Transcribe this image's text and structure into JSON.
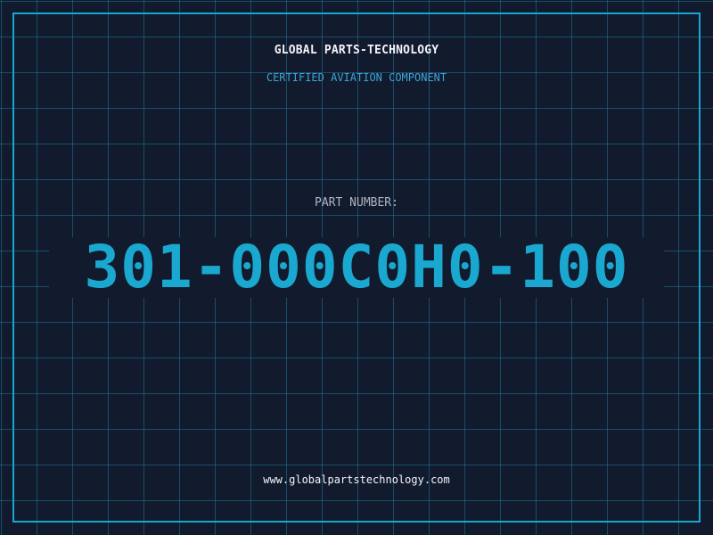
{
  "header": {
    "company_name": "GLOBAL PARTS-TECHNOLOGY",
    "tagline": "CERTIFIED AVIATION COMPONENT"
  },
  "part": {
    "label": "PART NUMBER:",
    "number": "301-000C0H0-100"
  },
  "footer": {
    "website": "www.globalpartstechnology.com"
  },
  "colors": {
    "background": "#121a2e",
    "grid": "#1f7896",
    "frame": "#18a7cf",
    "accent": "#1aa8d0",
    "text_primary": "#f2f4f7",
    "text_muted": "#aeb4bf"
  }
}
